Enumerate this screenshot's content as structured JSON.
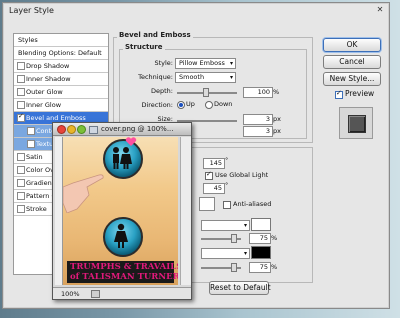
{
  "dialog": {
    "title": "Layer Style",
    "close_glyph": "✕"
  },
  "styles_list": {
    "items": [
      {
        "label": "Styles",
        "type": "header",
        "checked": null
      },
      {
        "label": "Blending Options: Default",
        "type": "header",
        "checked": null
      },
      {
        "label": "Drop Shadow",
        "checked": false
      },
      {
        "label": "Inner Shadow",
        "checked": false
      },
      {
        "label": "Outer Glow",
        "checked": false
      },
      {
        "label": "Inner Glow",
        "checked": false
      },
      {
        "label": "Bevel and Emboss",
        "checked": true,
        "selected": true
      },
      {
        "label": "Contour",
        "checked": false,
        "sub": true
      },
      {
        "label": "Texture",
        "checked": false,
        "sub": true
      },
      {
        "label": "Satin",
        "checked": false
      },
      {
        "label": "Color Overlay",
        "checked": false
      },
      {
        "label": "Gradient Overlay",
        "checked": false
      },
      {
        "label": "Pattern Overlay",
        "checked": false
      },
      {
        "label": "Stroke",
        "checked": false
      }
    ]
  },
  "bevel": {
    "group_title": "Bevel and Emboss",
    "structure_title": "Structure",
    "style_label": "Style:",
    "style_value": "Pillow Emboss",
    "technique_label": "Technique:",
    "technique_value": "Smooth",
    "depth_label": "Depth:",
    "depth_value": "100",
    "depth_unit": "%",
    "direction_label": "Direction:",
    "direction_up": "Up",
    "direction_down": "Down",
    "size_label": "Size:",
    "size_value": "3",
    "size_unit": "px",
    "soften_value": "3",
    "soften_unit": "px"
  },
  "shading": {
    "angle_value": "145",
    "degree_glyph": "°",
    "use_global_light": "Use Global Light",
    "altitude_value": "45",
    "anti_aliased": "Anti-aliased",
    "highlight_opacity": "75",
    "shadow_opacity": "75",
    "percent": "%"
  },
  "buttons": {
    "ok": "OK",
    "cancel": "Cancel",
    "new_style": "New Style...",
    "preview": "Preview",
    "reset_to_default": "Reset to Default"
  },
  "image_window": {
    "title": "cover.png @ 100%...",
    "zoom": "100%",
    "banner_line1": "TRUMPHS & TRAVAILS",
    "banner_line2": "of TALISMAN TURNER"
  },
  "colors": {
    "selection": "#3874d8",
    "banner_text": "#e0197a",
    "heart": "#ff4fa0",
    "icon_teal": "#2aa1c4"
  },
  "icons": [
    "close-icon",
    "couple-icon",
    "heart-icon",
    "woman-icon",
    "pointing-finger-icon"
  ]
}
